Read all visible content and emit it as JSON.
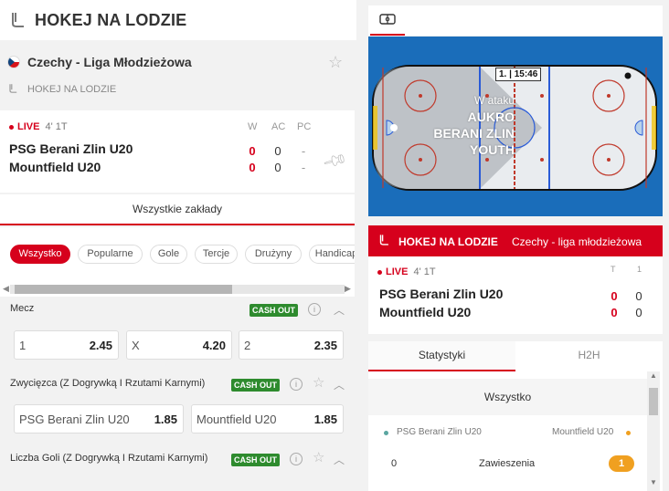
{
  "header": {
    "title": "HOKEJ NA LODZIE",
    "icon": "hockey-stick-icon"
  },
  "league": {
    "name": "Czechy - Liga Młodzieżowa",
    "sport_label": "HOKEJ NA LODZIE"
  },
  "match": {
    "live_label": "LIVE",
    "period": "4' 1T",
    "col_w": "W",
    "col_ac": "AC",
    "col_pc": "PC",
    "home": {
      "name": "PSG Berani Zlin U20",
      "w": "0",
      "ac": "0",
      "pc": "-"
    },
    "away": {
      "name": "Mountfield U20",
      "w": "0",
      "ac": "0",
      "pc": "-"
    }
  },
  "all_bets": "Wszystkie zakłady",
  "filters": [
    "Wszystko",
    "Popularne",
    "Gole",
    "Tercje",
    "Drużyny",
    "Handicap"
  ],
  "markets": [
    {
      "title": "Mecz",
      "cashout": "CASH OUT",
      "odds": [
        {
          "label": "1",
          "value": "2.45"
        },
        {
          "label": "X",
          "value": "4.20"
        },
        {
          "label": "2",
          "value": "2.35"
        }
      ]
    },
    {
      "title": "Zwycięzca (Z Dogrywką I Rzutami Karnymi)",
      "cashout": "CASH OUT",
      "odds": [
        {
          "label": "PSG Berani Zlin U20",
          "value": "1.85"
        },
        {
          "label": "Mountfield U20",
          "value": "1.85"
        }
      ]
    },
    {
      "title": "Liczba Goli (Z Dogrywką I Rzutami Karnymi)",
      "cashout": "CASH OUT"
    }
  ],
  "tracker": {
    "tab_icon": "rink-icon",
    "clock": "1. | 15:46",
    "attack_prefix": "W ataku",
    "attack_team": [
      "AUKRO",
      "BERANI ZLIN",
      "YOUTH"
    ]
  },
  "scoreboard": {
    "sport": "HOKEJ NA LODZIE",
    "league": "Czechy - liga młodzieżowa",
    "live_label": "LIVE",
    "period": "4' 1T",
    "col_t": "T",
    "col_1": "1",
    "home": {
      "name": "PSG Berani Zlin U20",
      "t": "0",
      "p1": "0"
    },
    "away": {
      "name": "Mountfield U20",
      "t": "0",
      "p1": "0"
    }
  },
  "stats": {
    "tabs": [
      "Statystyki",
      "H2H"
    ],
    "filter": "Wszystko",
    "home": "PSG Berani Zlin U20",
    "away": "Mountfield U20",
    "home_color": "#5aa6a0",
    "away_color": "#f0a020",
    "row": {
      "home_val": "0",
      "label": "Zawieszenia",
      "away_val": "1"
    }
  }
}
